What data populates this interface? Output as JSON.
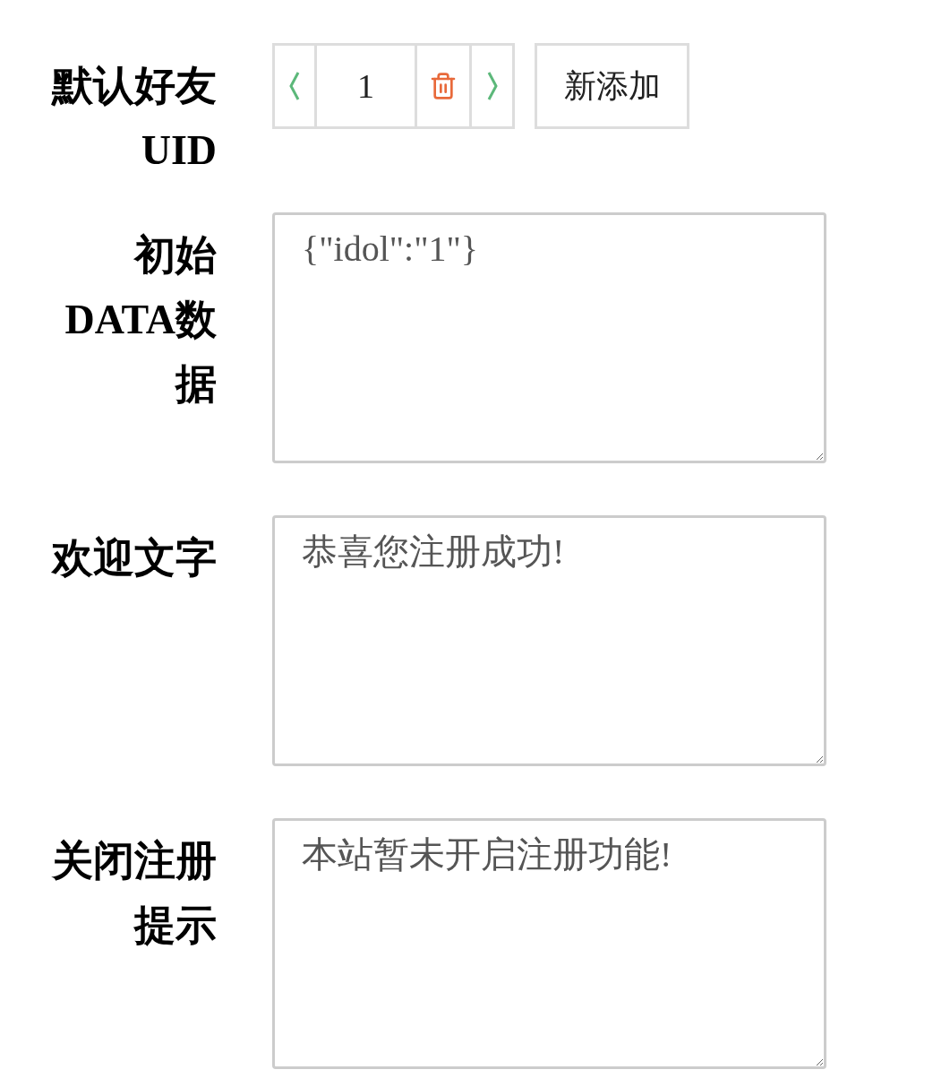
{
  "fields": [
    {
      "kind": "stepper",
      "label": "默认好友UID",
      "value": "1",
      "add_button": "新添加"
    },
    {
      "kind": "textarea",
      "label": "初始DATA数据",
      "value": "{\"idol\":\"1\"}"
    },
    {
      "kind": "textarea",
      "label": "欢迎文字",
      "value": "恭喜您注册成功!"
    },
    {
      "kind": "textarea",
      "label": "关闭注册提示",
      "value": "本站暂未开启注册功能!"
    }
  ]
}
